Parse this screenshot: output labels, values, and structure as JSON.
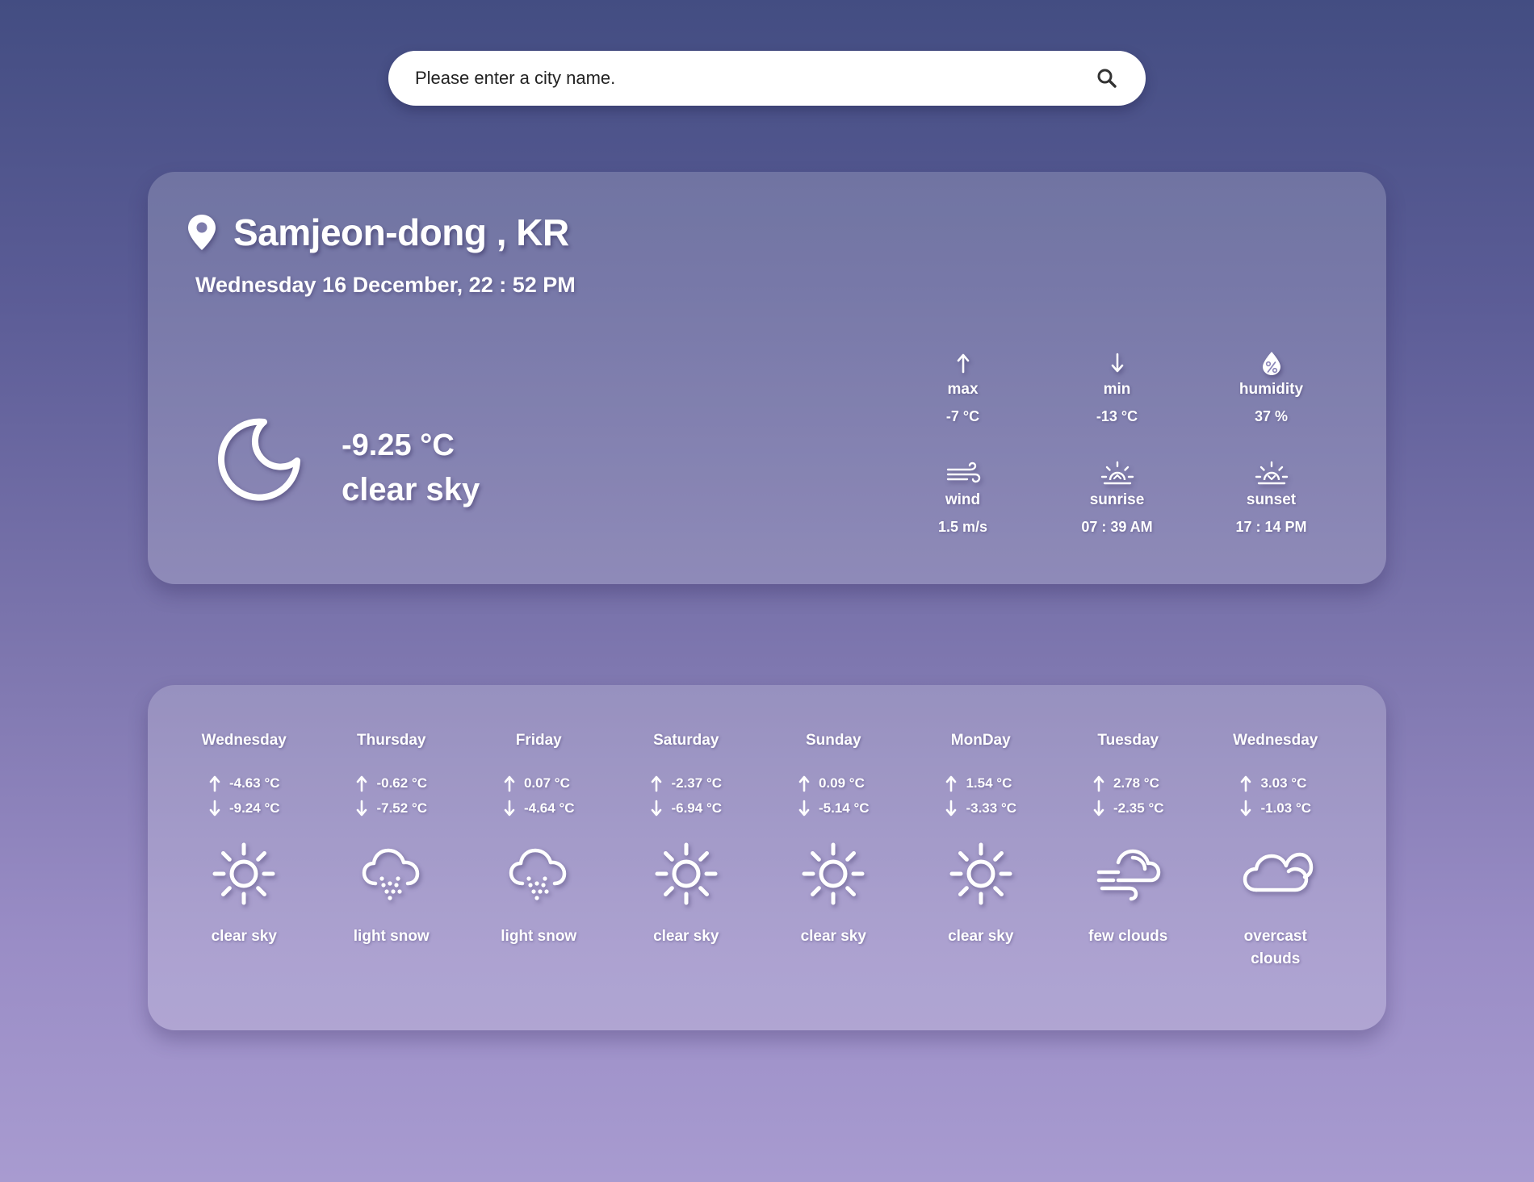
{
  "search": {
    "placeholder": "Please enter a city name.",
    "icon": "search-icon"
  },
  "current": {
    "location_icon": "map-pin-icon",
    "city": "Samjeon-dong , KR",
    "datetime": "Wednesday 16 December, 22 : 52 PM",
    "icon": "moon-icon",
    "temperature": "-9.25 °C",
    "description": "clear sky",
    "stats": [
      {
        "key": "max",
        "icon": "arrow-up-icon",
        "label": "max",
        "value": "-7 °C"
      },
      {
        "key": "min",
        "icon": "arrow-down-icon",
        "label": "min",
        "value": "-13 °C"
      },
      {
        "key": "humidity",
        "icon": "humidity-drop-icon",
        "label": "humidity",
        "value": "37 %"
      },
      {
        "key": "wind",
        "icon": "wind-icon",
        "label": "wind",
        "value": "1.5 m/s"
      },
      {
        "key": "sunrise",
        "icon": "sunrise-icon",
        "label": "sunrise",
        "value": "07 : 39 AM"
      },
      {
        "key": "sunset",
        "icon": "sunset-icon",
        "label": "sunset",
        "value": "17 : 14 PM"
      }
    ]
  },
  "forecast": [
    {
      "day": "Wednesday",
      "max": "-4.63 °C",
      "min": "-9.24 °C",
      "icon": "sun-icon",
      "description": "clear sky"
    },
    {
      "day": "Thursday",
      "max": "-0.62 °C",
      "min": "-7.52 °C",
      "icon": "snow-cloud-icon",
      "description": "light snow"
    },
    {
      "day": "Friday",
      "max": "0.07 °C",
      "min": "-4.64 °C",
      "icon": "snow-cloud-icon",
      "description": "light snow"
    },
    {
      "day": "Saturday",
      "max": "-2.37 °C",
      "min": "-6.94 °C",
      "icon": "sun-icon",
      "description": "clear sky"
    },
    {
      "day": "Sunday",
      "max": "0.09 °C",
      "min": "-5.14 °C",
      "icon": "sun-icon",
      "description": "clear sky"
    },
    {
      "day": "MonDay",
      "max": "1.54 °C",
      "min": "-3.33 °C",
      "icon": "sun-icon",
      "description": "clear sky"
    },
    {
      "day": "Tuesday",
      "max": "2.78 °C",
      "min": "-2.35 °C",
      "icon": "windy-cloud-icon",
      "description": "few clouds"
    },
    {
      "day": "Wednesday",
      "max": "3.03 °C",
      "min": "-1.03 °C",
      "icon": "cloud-icon",
      "description": "overcast clouds"
    }
  ],
  "colors": {
    "background_top": "#434d82",
    "background_bottom": "#a89bd0",
    "card": "rgba(255,255,255,0.18)",
    "text": "#ffffff"
  }
}
